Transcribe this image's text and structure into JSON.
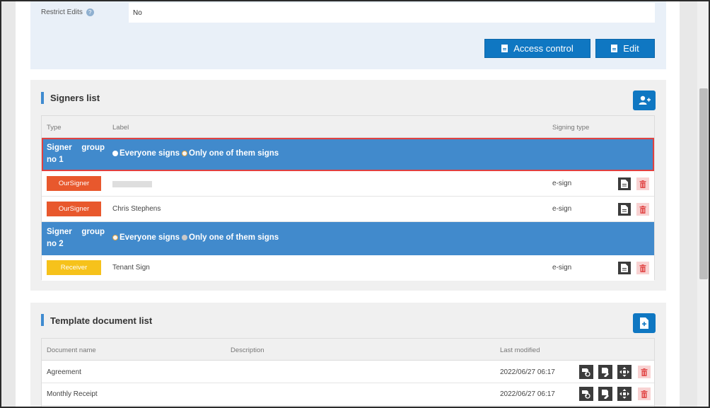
{
  "restrict_edits": {
    "label": "Restrict Edits",
    "value": "No"
  },
  "top_buttons": {
    "access_control": "Access control",
    "edit": "Edit"
  },
  "signers": {
    "title": "Signers list",
    "headers": {
      "type": "Type",
      "label": "Label",
      "signing_type": "Signing type"
    },
    "groups": [
      {
        "name_a": "Signer",
        "name_b": "group",
        "name_c": "no 1",
        "opt1": "Everyone signs",
        "opt2": "Only one of them signs"
      },
      {
        "name_a": "Signer",
        "name_b": "group",
        "name_c": "no 2",
        "opt1": "Everyone signs",
        "opt2": "Only one of them signs"
      }
    ],
    "rows": [
      {
        "type": "OurSigner",
        "label": "",
        "signing": "e-sign"
      },
      {
        "type": "OurSigner",
        "label": "Chris Stephens",
        "signing": "e-sign"
      },
      {
        "type": "Receiver",
        "label": "Tenant Sign",
        "signing": "e-sign"
      }
    ]
  },
  "templates": {
    "title": "Template document list",
    "headers": {
      "name": "Document name",
      "description": "Description",
      "modified": "Last modified"
    },
    "rows": [
      {
        "name": "Agreement",
        "description": "",
        "modified": "2022/06/27 06:17"
      },
      {
        "name": "Monthly Receipt",
        "description": "",
        "modified": "2022/06/27 06:17"
      }
    ]
  },
  "colors": {
    "primary": "#0f77c2",
    "group_row": "#418acc",
    "oursigner": "#e8582d",
    "receiver": "#f6c21b"
  },
  "icons": [
    "question-icon",
    "document-icon",
    "add-user-icon",
    "add-document-icon",
    "delete-icon",
    "preview-icon",
    "edit-fields-icon",
    "move-icon"
  ]
}
